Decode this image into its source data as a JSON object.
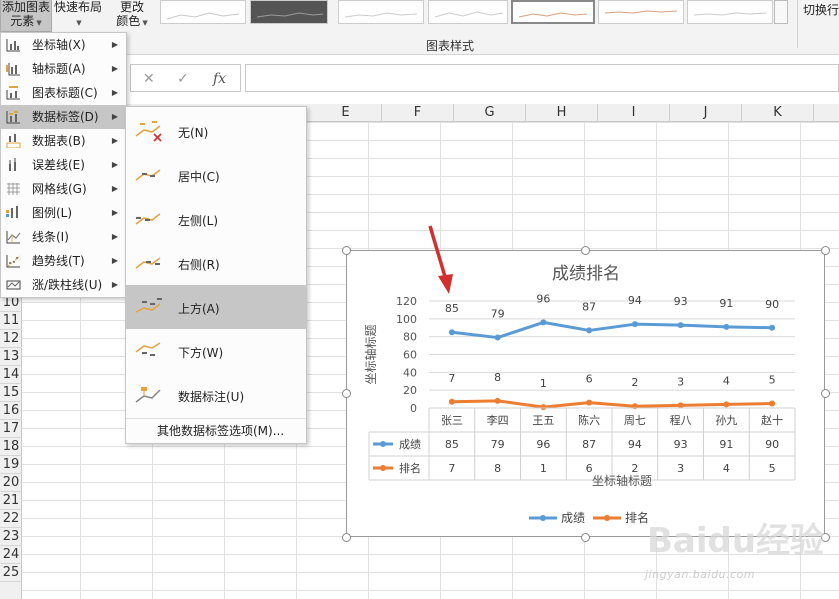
{
  "ribbon": {
    "add_element": {
      "line1": "添加图表",
      "line2": "元素"
    },
    "quick_layout": {
      "line1": "快速布局"
    },
    "change_color": {
      "line1": "更改",
      "line2": "颜色"
    },
    "gallery_label": "图表样式",
    "switch_label": "切换行"
  },
  "formula_bar": {
    "cancel": "✕",
    "confirm": "✓",
    "fx": "fx",
    "value": ""
  },
  "columns": [
    "E",
    "F",
    "G",
    "H",
    "I",
    "J",
    "K"
  ],
  "rows": [
    "10",
    "11",
    "12",
    "13",
    "14",
    "15",
    "16",
    "17",
    "18",
    "19",
    "20",
    "21",
    "22",
    "23",
    "24",
    "25"
  ],
  "menu_main": {
    "items": [
      {
        "label": "坐标轴(X)",
        "icon": "axis-icon",
        "has_submenu": true
      },
      {
        "label": "轴标题(A)",
        "icon": "axis-title-icon",
        "has_submenu": true
      },
      {
        "label": "图表标题(C)",
        "icon": "chart-title-icon",
        "has_submenu": true
      },
      {
        "label": "数据标签(D)",
        "icon": "data-labels-icon",
        "has_submenu": true,
        "active": true
      },
      {
        "label": "数据表(B)",
        "icon": "data-table-icon",
        "has_submenu": true
      },
      {
        "label": "误差线(E)",
        "icon": "error-bars-icon",
        "has_submenu": true
      },
      {
        "label": "网格线(G)",
        "icon": "gridlines-icon",
        "has_submenu": true
      },
      {
        "label": "图例(L)",
        "icon": "legend-icon",
        "has_submenu": true
      },
      {
        "label": "线条(I)",
        "icon": "lines-icon",
        "has_submenu": true
      },
      {
        "label": "趋势线(T)",
        "icon": "trendline-icon",
        "has_submenu": true
      },
      {
        "label": "涨/跌柱线(U)",
        "icon": "up-down-bars-icon",
        "has_submenu": true
      }
    ]
  },
  "menu_sub": {
    "items": [
      {
        "label": "无(N)",
        "icon": "labels-none-icon"
      },
      {
        "label": "居中(C)",
        "icon": "labels-center-icon"
      },
      {
        "label": "左侧(L)",
        "icon": "labels-left-icon"
      },
      {
        "label": "右侧(R)",
        "icon": "labels-right-icon"
      },
      {
        "label": "上方(A)",
        "icon": "labels-above-icon",
        "active": true
      },
      {
        "label": "下方(W)",
        "icon": "labels-below-icon"
      },
      {
        "label": "数据标注(U)",
        "icon": "data-callout-icon"
      }
    ],
    "more": "其他数据标签选项(M)..."
  },
  "chart_data": {
    "type": "line",
    "title": "成绩排名",
    "ylabel": "坐标轴标题",
    "xlabel": "坐标轴标题",
    "categories": [
      "张三",
      "李四",
      "王五",
      "陈六",
      "周七",
      "程八",
      "孙九",
      "赵十"
    ],
    "ylim": [
      0,
      120
    ],
    "yticks": [
      "0",
      "20",
      "40",
      "60",
      "80",
      "100",
      "120"
    ],
    "grid": true,
    "legend_position": "bottom",
    "data_labels": "above",
    "data_table": true,
    "series": [
      {
        "name": "成绩",
        "color": "#5b9bd5",
        "values": [
          85,
          79,
          96,
          87,
          94,
          93,
          91,
          90
        ]
      },
      {
        "name": "排名",
        "color": "#ed7d31",
        "values": [
          7,
          8,
          1,
          6,
          2,
          3,
          4,
          5
        ]
      }
    ]
  },
  "watermark": {
    "text": "Baidu经验",
    "url": "jingyan.baidu.com"
  },
  "colors": {
    "accent_red": "#d32f2f",
    "menu_highlight": "#c6c6c6"
  }
}
